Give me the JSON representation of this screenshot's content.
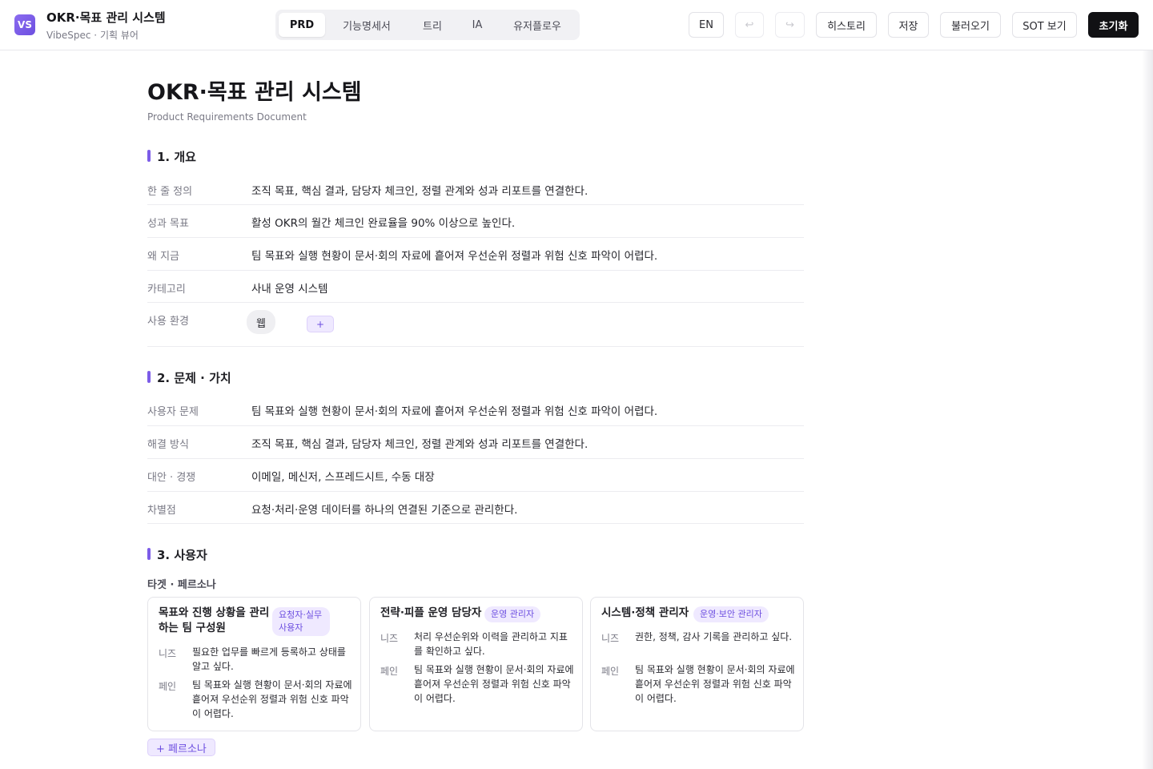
{
  "header": {
    "logo_text": "VS",
    "app_title": "OKR·목표 관리 시스템",
    "app_subtitle": "VibeSpec · 기획 뷰어",
    "tabs": [
      {
        "label": "PRD",
        "active": true
      },
      {
        "label": "기능명세서",
        "active": false
      },
      {
        "label": "트리",
        "active": false
      },
      {
        "label": "IA",
        "active": false
      },
      {
        "label": "유저플로우",
        "active": false
      }
    ],
    "lang_label": "EN",
    "undo_icon": "↩",
    "redo_icon": "↪",
    "history_label": "히스토리",
    "save_label": "저장",
    "load_label": "불러오기",
    "sot_label": "SOT 보기",
    "reset_label": "초기화"
  },
  "doc": {
    "title": "OKR·목표 관리 시스템",
    "subtitle": "Product Requirements Document",
    "sections": [
      {
        "heading": "1. 개요",
        "rows": [
          {
            "key": "한 줄 정의",
            "value": "조직 목표, 핵심 결과, 담당자 체크인, 정렬 관계와 성과 리포트를 연결한다."
          },
          {
            "key": "성과 목표",
            "value": "활성 OKR의 월간 체크인 완료율을 90% 이상으로 높인다."
          },
          {
            "key": "왜 지금",
            "value": "팀 목표와 실행 현황이 문서·회의 자료에 흩어져 우선순위 정렬과 위험 신호 파악이 어렵다."
          },
          {
            "key": "카테고리",
            "value": "사내 운영 시스템"
          },
          {
            "key": "사용 환경",
            "chip": "웹",
            "add_label": "+"
          }
        ]
      },
      {
        "heading": "2. 문제 · 가치",
        "rows": [
          {
            "key": "사용자 문제",
            "value": "팀 목표와 실행 현황이 문서·회의 자료에 흩어져 우선순위 정렬과 위험 신호 파악이 어렵다."
          },
          {
            "key": "해결 방식",
            "value": "조직 목표, 핵심 결과, 담당자 체크인, 정렬 관계와 성과 리포트를 연결한다."
          },
          {
            "key": "대안 · 경쟁",
            "value": "이메일, 메신저, 스프레드시트, 수동 대장"
          },
          {
            "key": "차별점",
            "value": "요청·처리·운영 데이터를 하나의 연결된 기준으로 관리한다."
          }
        ]
      },
      {
        "heading": "3. 사용자",
        "subheading": "타겟 · 페르소나",
        "personas": [
          {
            "title": "목표와 진행 상황을 관리하는 팀 구성원",
            "badge": "요청자·실무 사용자",
            "needs_label": "니즈",
            "needs": "필요한 업무를 빠르게 등록하고 상태를 알고 싶다.",
            "pain_label": "페인",
            "pain": "팀 목표와 실행 현황이 문서·회의 자료에 흩어져 우선순위 정렬과 위험 신호 파악이 어렵다."
          },
          {
            "title": "전략·피플 운영 담당자",
            "badge": "운영 관리자",
            "needs_label": "니즈",
            "needs": "처리 우선순위와 이력을 관리하고 지표를 확인하고 싶다.",
            "pain_label": "페인",
            "pain": "팀 목표와 실행 현황이 문서·회의 자료에 흩어져 우선순위 정렬과 위험 신호 파악이 어렵다."
          },
          {
            "title": "시스템·정책 관리자",
            "badge": "운영·보안 관리자",
            "needs_label": "니즈",
            "needs": "권한, 정책, 감사 기록을 관리하고 싶다.",
            "pain_label": "페인",
            "pain": "팀 목표와 실행 현황이 문서·회의 자료에 흩어져 우선순위 정렬과 위험 신호 파악이 어렵다."
          }
        ],
        "add_persona_label": "+ 페르소나"
      }
    ]
  }
}
